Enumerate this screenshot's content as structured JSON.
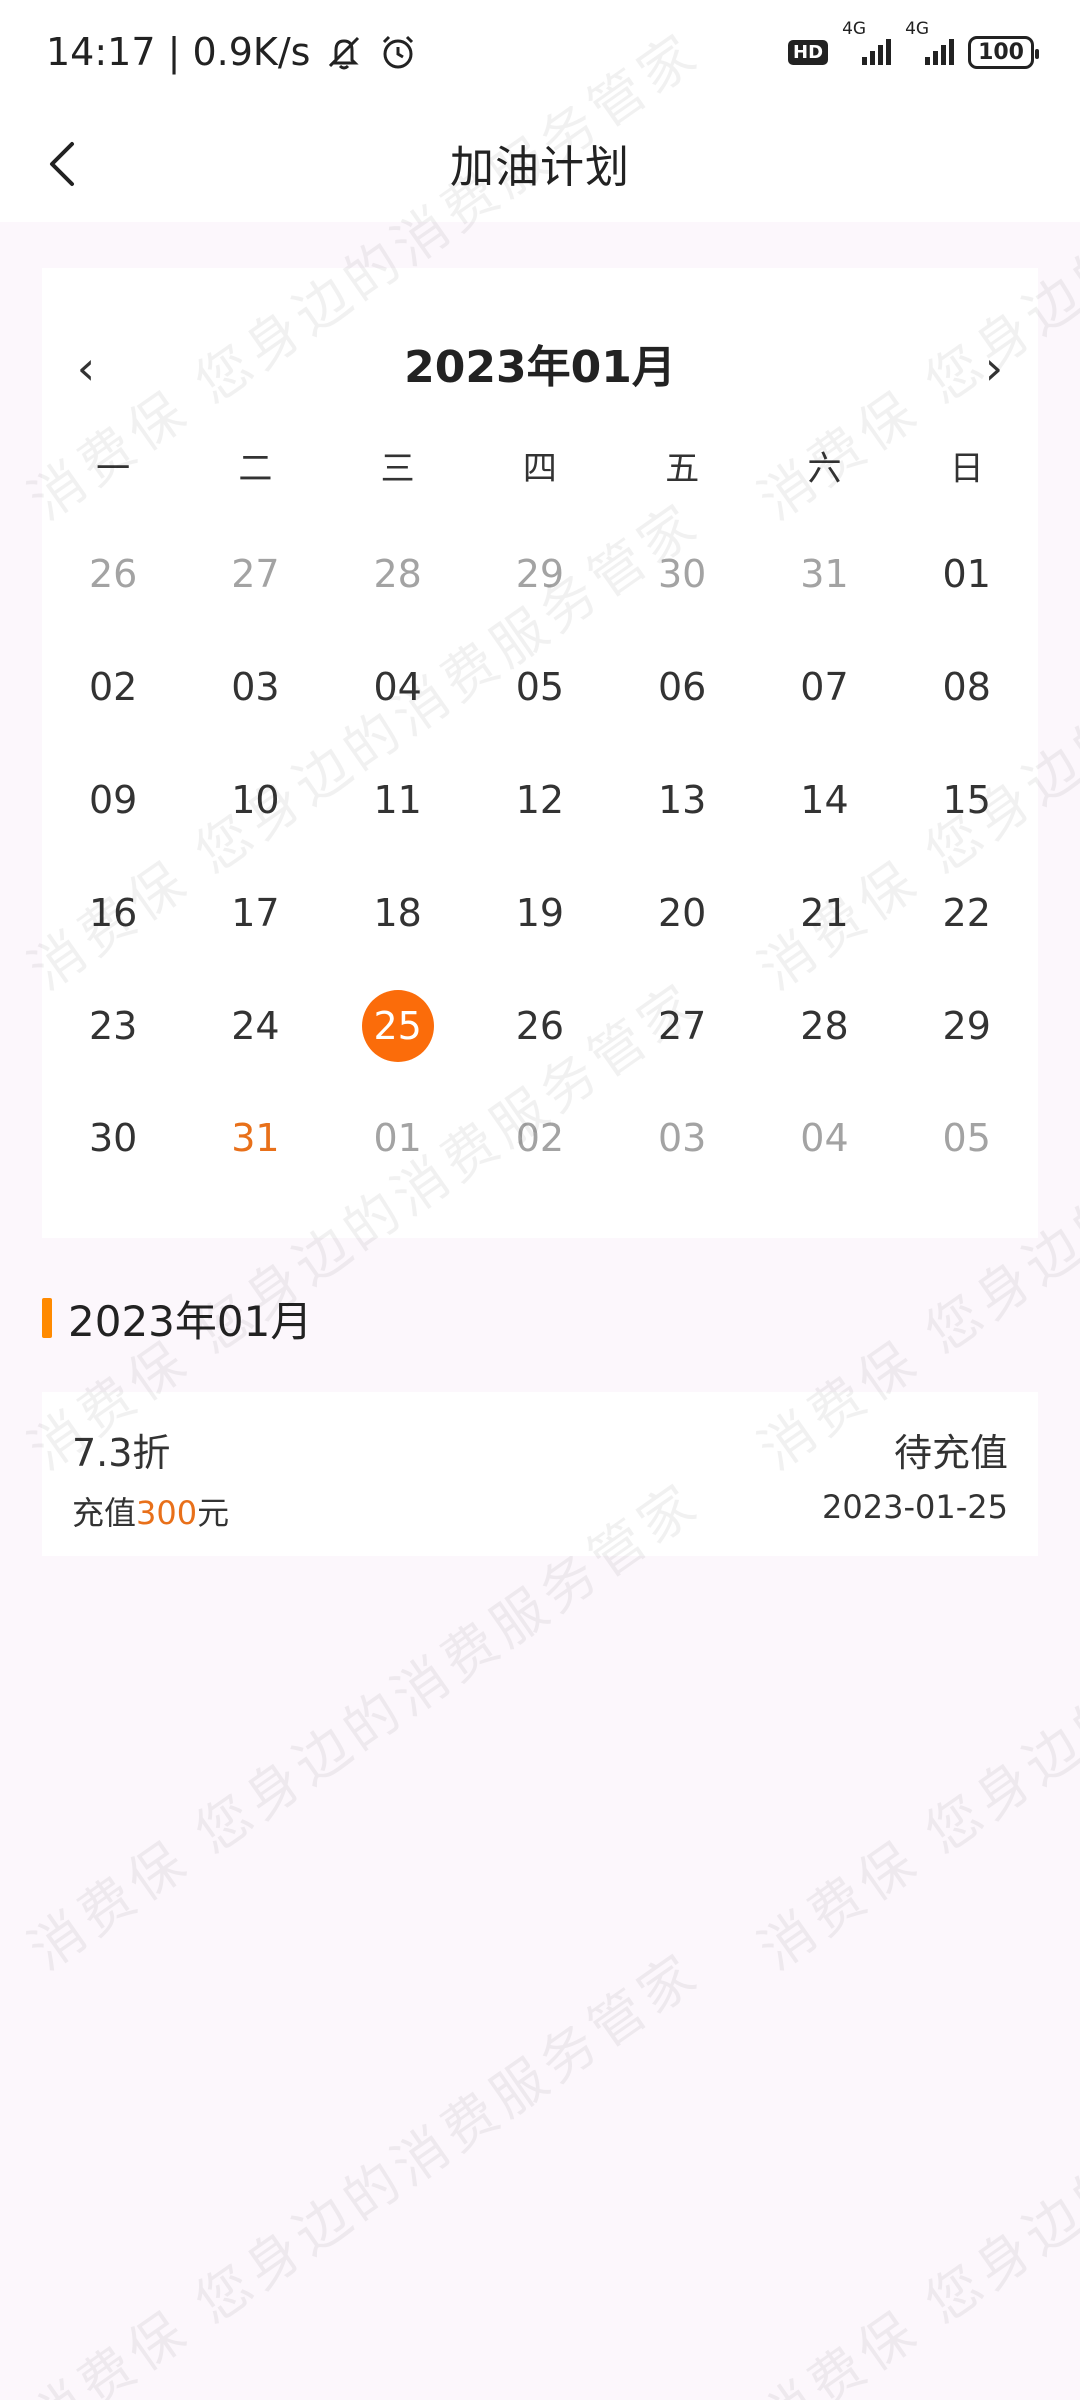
{
  "status_bar": {
    "time_speed": "14:17 | 0.9K/s",
    "hd_label": "HD",
    "net1": "4G",
    "net2": "4G",
    "battery": "100"
  },
  "header": {
    "title": "加油计划"
  },
  "calendar": {
    "prev_label": "‹",
    "next_label": "›",
    "month_title": "2023年01月",
    "weekdays": [
      "一",
      "二",
      "三",
      "四",
      "五",
      "六",
      "日"
    ],
    "days": [
      {
        "num": "26",
        "state": "muted"
      },
      {
        "num": "27",
        "state": "muted"
      },
      {
        "num": "28",
        "state": "muted"
      },
      {
        "num": "29",
        "state": "muted"
      },
      {
        "num": "30",
        "state": "muted"
      },
      {
        "num": "31",
        "state": "muted"
      },
      {
        "num": "01",
        "state": "normal"
      },
      {
        "num": "02",
        "state": "normal"
      },
      {
        "num": "03",
        "state": "normal"
      },
      {
        "num": "04",
        "state": "normal"
      },
      {
        "num": "05",
        "state": "normal"
      },
      {
        "num": "06",
        "state": "normal"
      },
      {
        "num": "07",
        "state": "normal"
      },
      {
        "num": "08",
        "state": "normal"
      },
      {
        "num": "09",
        "state": "normal"
      },
      {
        "num": "10",
        "state": "normal"
      },
      {
        "num": "11",
        "state": "normal"
      },
      {
        "num": "12",
        "state": "normal"
      },
      {
        "num": "13",
        "state": "normal"
      },
      {
        "num": "14",
        "state": "normal"
      },
      {
        "num": "15",
        "state": "normal"
      },
      {
        "num": "16",
        "state": "normal"
      },
      {
        "num": "17",
        "state": "normal"
      },
      {
        "num": "18",
        "state": "normal"
      },
      {
        "num": "19",
        "state": "normal"
      },
      {
        "num": "20",
        "state": "normal"
      },
      {
        "num": "21",
        "state": "normal"
      },
      {
        "num": "22",
        "state": "normal"
      },
      {
        "num": "23",
        "state": "normal"
      },
      {
        "num": "24",
        "state": "normal"
      },
      {
        "num": "25",
        "state": "selected"
      },
      {
        "num": "26",
        "state": "normal"
      },
      {
        "num": "27",
        "state": "normal"
      },
      {
        "num": "28",
        "state": "normal"
      },
      {
        "num": "29",
        "state": "normal"
      },
      {
        "num": "30",
        "state": "normal"
      },
      {
        "num": "31",
        "state": "highlight"
      },
      {
        "num": "01",
        "state": "muted"
      },
      {
        "num": "02",
        "state": "muted"
      },
      {
        "num": "03",
        "state": "muted"
      },
      {
        "num": "04",
        "state": "muted"
      },
      {
        "num": "05",
        "state": "muted"
      }
    ]
  },
  "section": {
    "title": "2023年01月"
  },
  "plan": {
    "discount": "7.3折",
    "amount_prefix": "充值",
    "amount_value": "300",
    "amount_suffix": "元",
    "status": "待充值",
    "date": "2023-01-25"
  },
  "watermark": {
    "line1": "消费保 您身边的消费服务管家"
  },
  "colors": {
    "accent": "#fb6c0a",
    "accent_text": "#e8701a",
    "section_bar": "#ff8a00",
    "background": "#fcf7fc",
    "muted_text": "#a3a3a3"
  },
  "icons": {
    "back": "chevron-left-icon",
    "mute": "bell-off-icon",
    "alarm": "alarm-clock-icon"
  }
}
